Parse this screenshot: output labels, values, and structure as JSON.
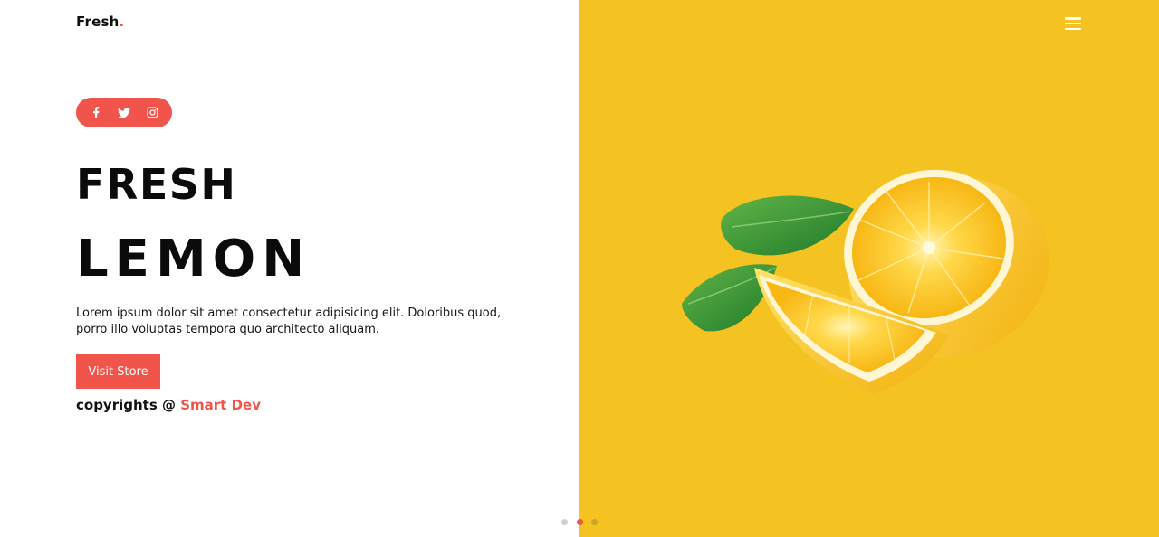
{
  "header": {
    "logo_text": "Fresh",
    "logo_dot": "."
  },
  "social": {
    "icons": [
      "facebook-icon",
      "twitter-icon",
      "instagram-icon"
    ],
    "color": "#f0544b"
  },
  "hero": {
    "title_line1": "FRESH",
    "title_line2": "LEMON",
    "description": "Lorem ipsum dolor sit amet consectetur adipisicing elit. Doloribus quod, porro illo voluptas tempora quo architecto aliquam.",
    "cta_label": "Visit Store"
  },
  "footer": {
    "copyright_prefix": "copyrights @",
    "copyright_brand": "Smart Dev"
  },
  "menu": {
    "icon": "hamburger-menu-icon"
  },
  "slider": {
    "dot_colors": [
      "#d0d0d0",
      "#f0544b",
      "#c9a52a"
    ],
    "active_index": 1
  },
  "colors": {
    "accent": "#f0544b",
    "panel": "#f4c322",
    "text": "#0b0b0b"
  }
}
